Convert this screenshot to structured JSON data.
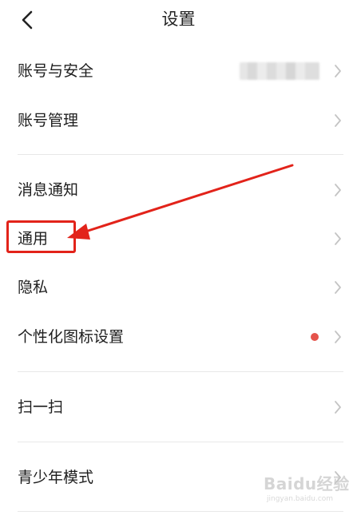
{
  "header": {
    "title": "设置"
  },
  "rows": [
    {
      "label": "账号与安全"
    },
    {
      "label": "账号管理"
    },
    {
      "label": "消息通知"
    },
    {
      "label": "通用"
    },
    {
      "label": "隐私"
    },
    {
      "label": "个性化图标设置"
    },
    {
      "label": "扫一扫"
    },
    {
      "label": "青少年模式"
    }
  ],
  "colors": {
    "highlight_annotation": "#e2231a",
    "badge_dot": "#e5534b",
    "chevron": "#c4c4c4",
    "divider": "#e8e8e8"
  },
  "watermark": {
    "brand": "Baidu经验",
    "url": "jingyan.baidu.com"
  }
}
